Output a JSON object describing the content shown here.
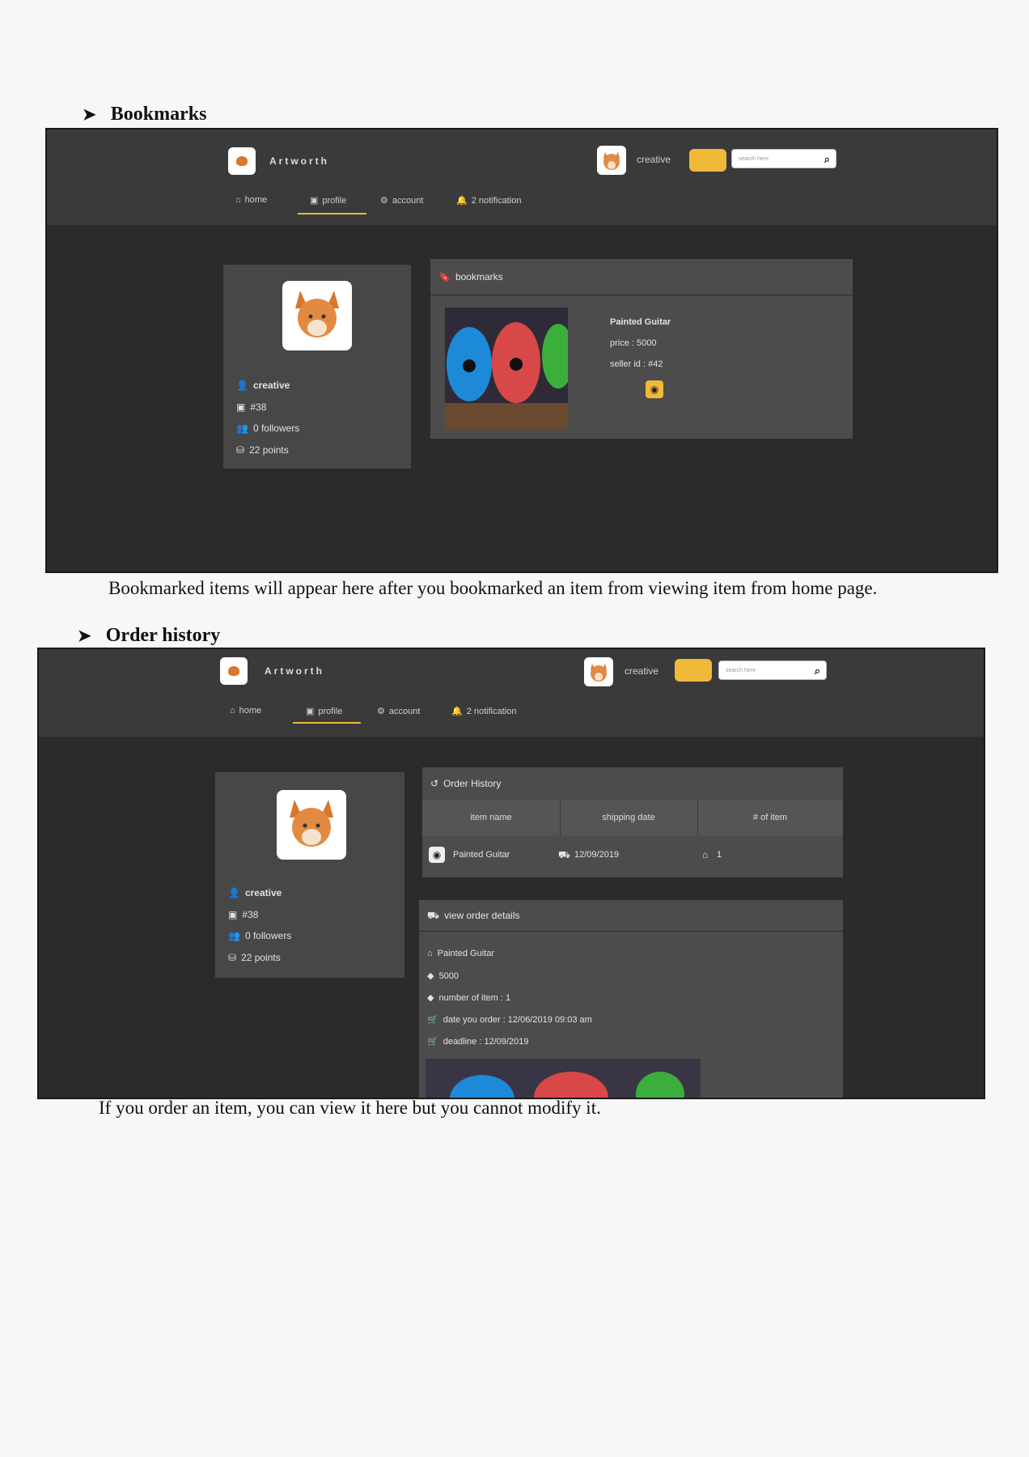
{
  "doc": {
    "section1_heading": "Bookmarks",
    "section1_caption": "Bookmarked items will appear here after you bookmarked an item from viewing item from home page.",
    "section2_heading": "Order history",
    "section2_caption": "If you order an item, you can view it here but you cannot modify it."
  },
  "app": {
    "brand": "Artworth",
    "username": "creative",
    "search_placeholder": "search here",
    "nav": {
      "home": "home",
      "profile": "profile",
      "account": "account",
      "notification": "2 notification"
    }
  },
  "profile": {
    "name": "creative",
    "id": "#38",
    "followers": "0 followers",
    "points": "22 points"
  },
  "bookmarks": {
    "heading": "bookmarks",
    "item": {
      "title": "Painted Guitar",
      "price": "price : 5000",
      "seller": "seller id : #42"
    }
  },
  "order_history": {
    "heading": "Order History",
    "columns": [
      "item name",
      "shipping date",
      "# of item"
    ],
    "row": {
      "name": "Painted Guitar",
      "date": "12/09/2019",
      "count": "1"
    }
  },
  "order_details": {
    "heading": "view order details",
    "name": "Painted Guitar",
    "price": "5000",
    "quantity": "number of item : 1",
    "order_date": "date you order : 12/06/2019 09:03 am",
    "deadline": "deadline : 12/09/2019"
  },
  "colors": {
    "accent": "#f0b93a",
    "background": "#2b2b2b",
    "card": "#474747"
  }
}
